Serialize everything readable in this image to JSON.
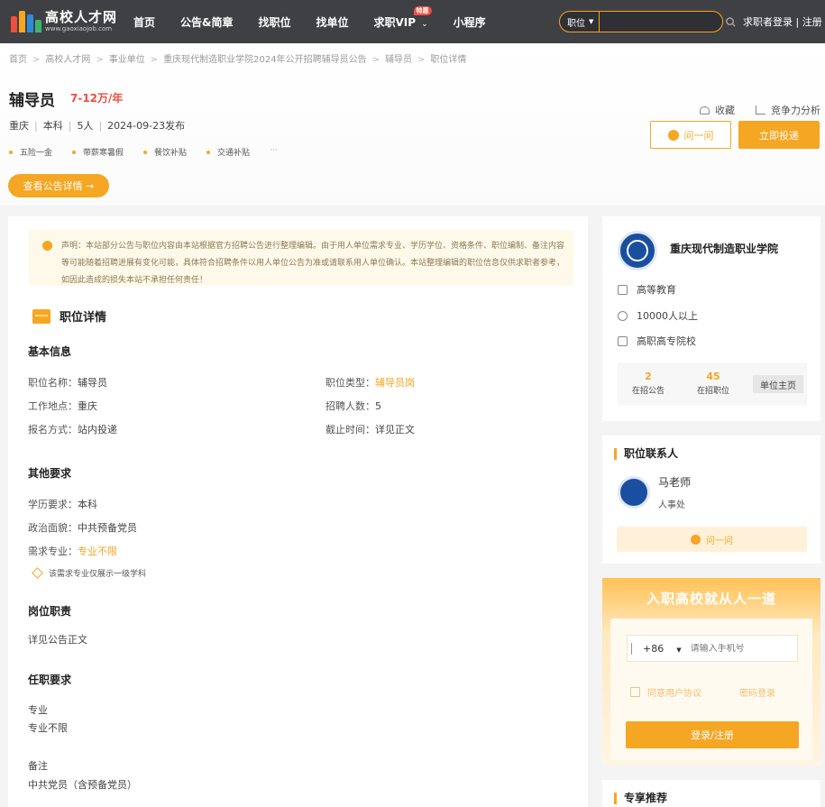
{
  "nav": {
    "logo_cn": "高校人才网",
    "logo_en": "www.gaoxiaojob.com",
    "items": [
      "首页",
      "公告&简章",
      "找职位",
      "找单位",
      "求职VIP",
      "小程序"
    ],
    "vip_badge": "特惠",
    "search_type": "职位",
    "search_placeholder": "",
    "login": "求职者登录",
    "register": "注册"
  },
  "breadcrumb": [
    "首页",
    "高校人才网",
    "事业单位",
    "重庆现代制造职业学院2024年公开招聘辅导员公告",
    "辅导员",
    "职位详情"
  ],
  "job": {
    "title": "辅导员",
    "salary": "7-12万/年",
    "location": "重庆",
    "education": "本科",
    "headcount": "5人",
    "published": "2024-09-23发布",
    "tags": [
      "五险一金",
      "带薪寒暑假",
      "餐饮补贴",
      "交通补贴"
    ],
    "tags_more": "···",
    "view_notice": "查看公告详情 →",
    "favorite": "收藏",
    "analysis": "竞争力分析",
    "ask": "问一问",
    "apply": "立即投递"
  },
  "notice": "声明：本站部分公告与职位内容由本站根据官方招聘公告进行整理编辑。由于用人单位需求专业、学历学位、资格条件、职位编制、备注内容等可能随着招聘进展有变化可能，具体符合招聘条件以用人单位公告为准或请联系用人单位确认。本站整理编辑的职位信息仅供求职者参考，如因此造成的损失本站不承担任何责任！",
  "detail": {
    "section_title": "职位详情",
    "basic_title": "基本信息",
    "basic": [
      {
        "k": "职位名称：",
        "v": "辅导员"
      },
      {
        "k": "职位类型：",
        "v": "辅导员岗"
      },
      {
        "k": "工作地点：",
        "v": "重庆"
      },
      {
        "k": "招聘人数：",
        "v": "5"
      },
      {
        "k": "报名方式：",
        "v": "站内投递"
      },
      {
        "k": "截止时间：",
        "v": "详见正文"
      }
    ],
    "other_title": "其他要求",
    "other": [
      {
        "k": "学历要求：",
        "v": "本科"
      },
      {
        "k": "政治面貌：",
        "v": "中共预备党员"
      },
      {
        "k": "需求专业：",
        "v": "专业不限"
      }
    ],
    "major_hint": "该需求专业仅展示一级学科",
    "duty_title": "岗位职责",
    "duty": "详见公告正文",
    "req_title": "任职要求",
    "req_lines": [
      "专业",
      "专业不限"
    ],
    "remark_label": "备注",
    "remark": "中共党员（含预备党员）"
  },
  "org": {
    "name": "重庆现代制造职业学院",
    "type": "高等教育",
    "size": "10000人以上",
    "category": "高职高专院校",
    "stats": [
      {
        "num": "2",
        "label": "在招公告"
      },
      {
        "num": "45",
        "label": "在招职位"
      }
    ],
    "home": "单位主页"
  },
  "contact": {
    "title": "职位联系人",
    "name": "马老师",
    "dept": "人事处",
    "ask": "问一问"
  },
  "join": {
    "title": "入职高校就从人一道",
    "country_code": "+86",
    "phone_placeholder": "请输入手机号",
    "agree": "同意用户协议",
    "pwd_login": "密码登录",
    "login_btn": "登录/注册"
  },
  "recommend": {
    "title": "专享推荐"
  },
  "colors": {
    "accent": "#f5a623",
    "nav_bg": "#3f4044",
    "salary": "#f04e3e"
  }
}
